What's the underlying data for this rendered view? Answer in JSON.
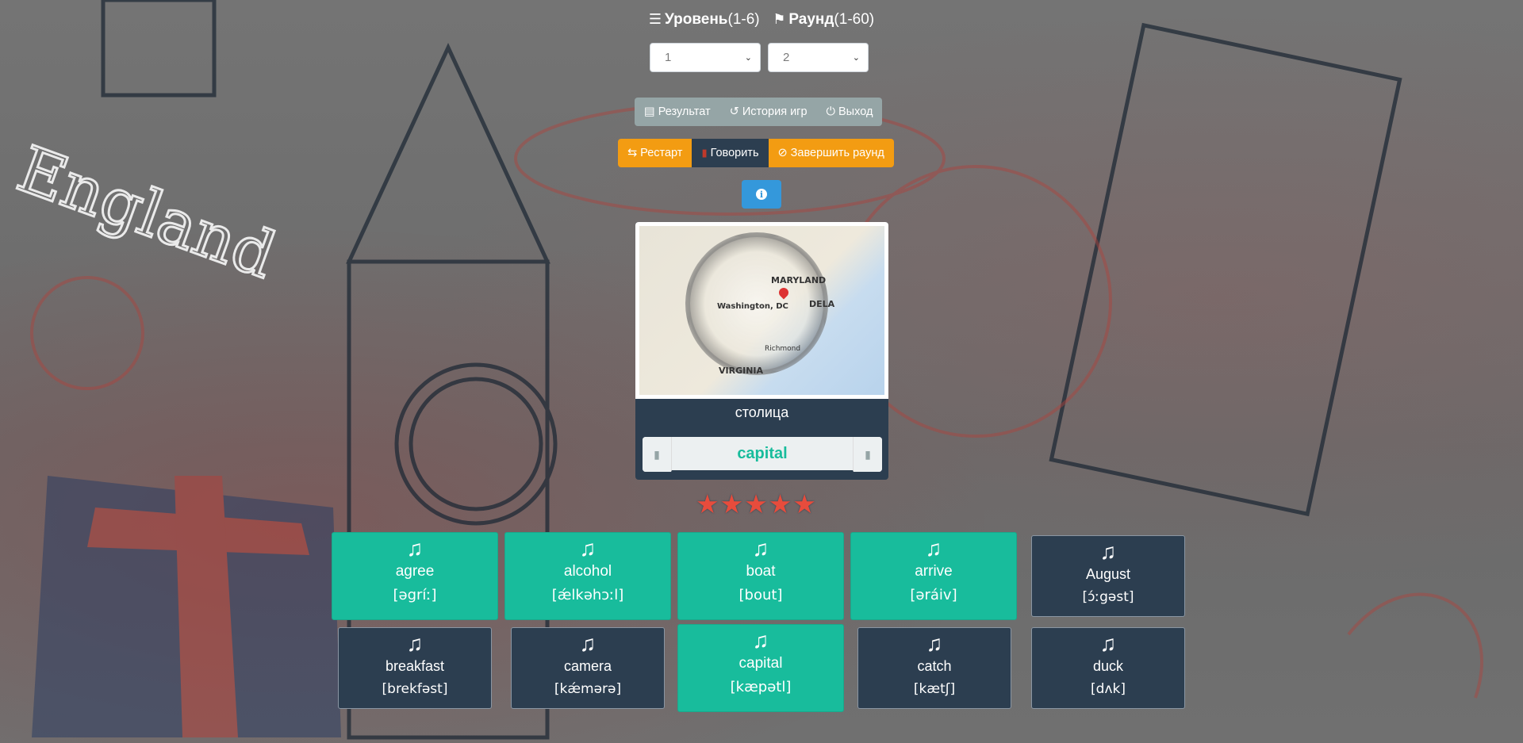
{
  "header": {
    "level_label": "Уровень",
    "level_range": "(1-6)",
    "round_label": "Раунд",
    "round_range": "(1-60)"
  },
  "selects": {
    "level_value": "1",
    "round_value": "2"
  },
  "nav": {
    "result": "Результат",
    "history": "История игр",
    "exit": "Выход"
  },
  "actions": {
    "restart": "Рестарт",
    "speak": "Говорить",
    "finish": "Завершить раунд"
  },
  "info_glyph": "i",
  "card": {
    "image_labels": {
      "maryland": "MARYLAND",
      "washington": "Washington, DC",
      "dela": "DELA",
      "richmond": "Richmond",
      "virginia": "VIRGINIA"
    },
    "translation": "столица",
    "answer": "capital"
  },
  "stars": {
    "rating": 5,
    "max": 5
  },
  "words": [
    {
      "word": "agree",
      "ipa": "[əgríː]",
      "state": "green"
    },
    {
      "word": "alcohol",
      "ipa": "[ǽlkəhɔːl]",
      "state": "green"
    },
    {
      "word": "boat",
      "ipa": "[bout]",
      "state": "green"
    },
    {
      "word": "arrive",
      "ipa": "[əráiv]",
      "state": "green"
    },
    {
      "word": "August",
      "ipa": "[ɔ́ːgəst]",
      "state": "navy"
    },
    {
      "word": "breakfast",
      "ipa": "[brekfəst]",
      "state": "navy"
    },
    {
      "word": "camera",
      "ipa": "[kǽmərə]",
      "state": "navy"
    },
    {
      "word": "capital",
      "ipa": "[kæpətl]",
      "state": "green"
    },
    {
      "word": "catch",
      "ipa": "[kætʃ]",
      "state": "navy"
    },
    {
      "word": "duck",
      "ipa": "[dʌk]",
      "state": "navy"
    }
  ],
  "colors": {
    "accent_green": "#18bc9c",
    "navy": "#2c3e50",
    "orange": "#f39c12",
    "gray_btn": "#95a5a6",
    "info_blue": "#3498db",
    "star_red": "#e74c3c"
  },
  "icons": {
    "level": "layers-icon",
    "round": "flag-icon",
    "result": "document-icon",
    "history": "history-icon",
    "exit": "power-icon",
    "restart": "retweet-icon",
    "speak": "microphone-icon",
    "finish": "ban-icon",
    "info": "info-icon",
    "tile": "music-note-icon"
  }
}
